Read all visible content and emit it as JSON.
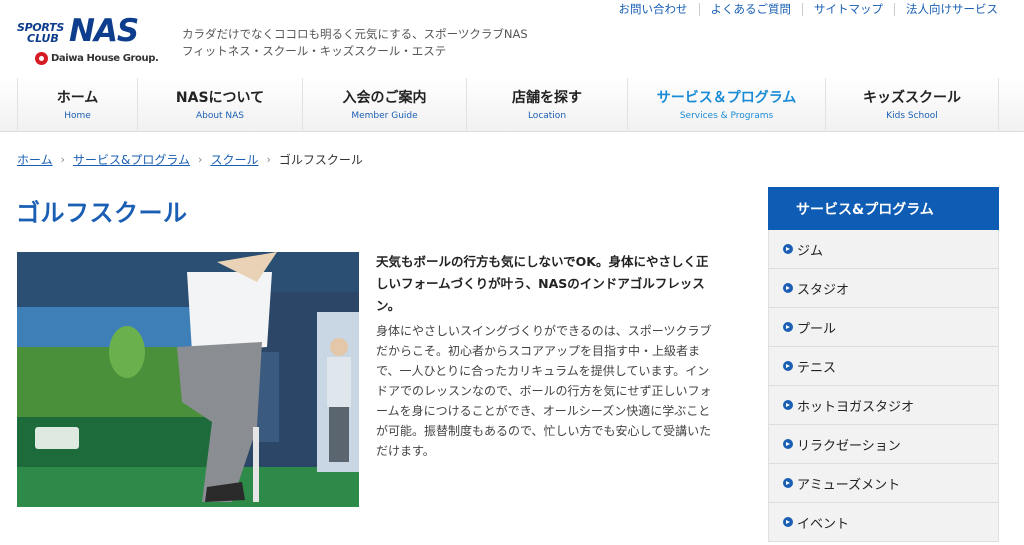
{
  "header": {
    "logo": {
      "line1": "SPORTS",
      "line2": "CLUB",
      "brand": "NAS",
      "group": "Daiwa House Group."
    },
    "tagline_line1": "カラダだけでなくココロも明るく元気にする、スポーツクラブNAS",
    "tagline_line2": "フィットネス・スクール・キッズスクール・エステ",
    "util_links": [
      "お問い合わせ",
      "よくあるご質問",
      "サイトマップ",
      "法人向けサービス"
    ]
  },
  "gnav": {
    "items": [
      {
        "jp": "ホーム",
        "en": "Home"
      },
      {
        "jp": "NASについて",
        "en": "About NAS"
      },
      {
        "jp": "入会のご案内",
        "en": "Member Guide"
      },
      {
        "jp": "店舗を探す",
        "en": "Location"
      },
      {
        "jp": "サービス＆プログラム",
        "en": "Services & Programs"
      },
      {
        "jp": "キッズスクール",
        "en": "Kids School"
      }
    ],
    "active_index": 4
  },
  "breadcrumb": {
    "items": [
      "ホーム",
      "サービス&プログラム",
      "スクール"
    ],
    "current": "ゴルフスクール"
  },
  "main": {
    "title": "ゴルフスクール",
    "lead": "天気もボールの行方も気にしないでOK。身体にやさしく正しいフォームづくりが叶う、NASのインドアゴルフレッスン。",
    "body": "身体にやさしいスイングづくりができるのは、スポーツクラブだからこそ。初心者からスコアアップを目指す中・上級者まで、一人ひとりに合ったカリキュラムを提供しています。インドアでのレッスンなので、ボールの行方を気にせず正しいフォームを身につけることができ、オールシーズン快適に学ぶことが可能。振替制度もあるので、忙しい方でも安心して受講いただけます。"
  },
  "sidebar": {
    "heading": "サービス&プログラム",
    "items": [
      "ジム",
      "スタジオ",
      "プール",
      "テニス",
      "ホットヨガスタジオ",
      "リラクゼーション",
      "アミューズメント",
      "イベント"
    ]
  },
  "colors": {
    "brand_blue": "#0e5cb3",
    "link_blue": "#1a5fb4",
    "active_nav": "#1a8bd6",
    "daiwa_red": "#d61b22"
  }
}
